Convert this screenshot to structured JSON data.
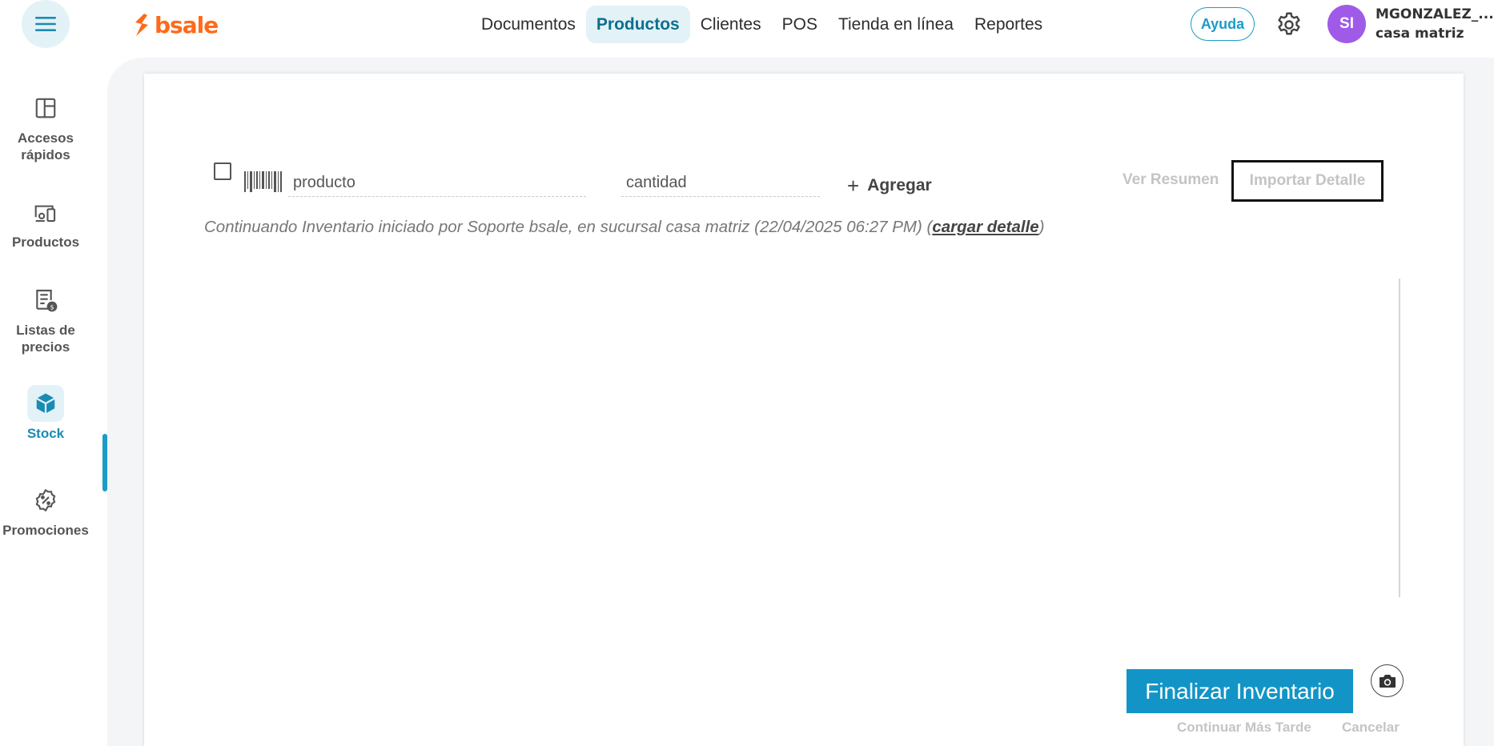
{
  "header": {
    "menu_icon": "hamburger-menu-icon",
    "logo_text": "bsale",
    "nav": [
      {
        "label": "Documentos",
        "active": false
      },
      {
        "label": "Productos",
        "active": true
      },
      {
        "label": "Clientes",
        "active": false
      },
      {
        "label": "POS",
        "active": false
      },
      {
        "label": "Tienda en línea",
        "active": false
      },
      {
        "label": "Reportes",
        "active": false
      }
    ],
    "help_label": "Ayuda",
    "settings_icon": "gear-icon",
    "user": {
      "initials": "SI",
      "name": "MGONZALEZ_...",
      "branch": "casa matriz"
    }
  },
  "sidebar": {
    "items": [
      {
        "label": "Accesos rápidos",
        "icon": "layout-icon",
        "active": false
      },
      {
        "label": "Productos",
        "icon": "devices-icon",
        "active": false
      },
      {
        "label": "Listas de precios",
        "icon": "price-list-icon",
        "active": false
      },
      {
        "label": "Stock",
        "icon": "box-icon",
        "active": true
      },
      {
        "label": "Promociones",
        "icon": "discount-badge-icon",
        "active": false
      }
    ]
  },
  "inventory": {
    "product_placeholder": "producto",
    "quantity_placeholder": "cantidad",
    "add_label": "Agregar",
    "summary_label": "Ver Resumen",
    "import_label": "Importar Detalle",
    "info_text": "Continuando Inventario iniciado por Soporte bsale, en sucursal casa matriz (22/04/2025 06:27 PM) ",
    "info_link_open": "(",
    "info_link": "cargar detalle",
    "info_link_close": ")"
  },
  "footer": {
    "finish_label": "Finalizar Inventario",
    "camera_icon": "camera-icon",
    "later_label": "Continuar Más Tarde",
    "cancel_label": "Cancelar"
  },
  "colors": {
    "brand_orange": "#ff6a1a",
    "accent_blue": "#1295c6",
    "active_bg": "#e3f2f7",
    "avatar_purple": "#a05ae8"
  }
}
